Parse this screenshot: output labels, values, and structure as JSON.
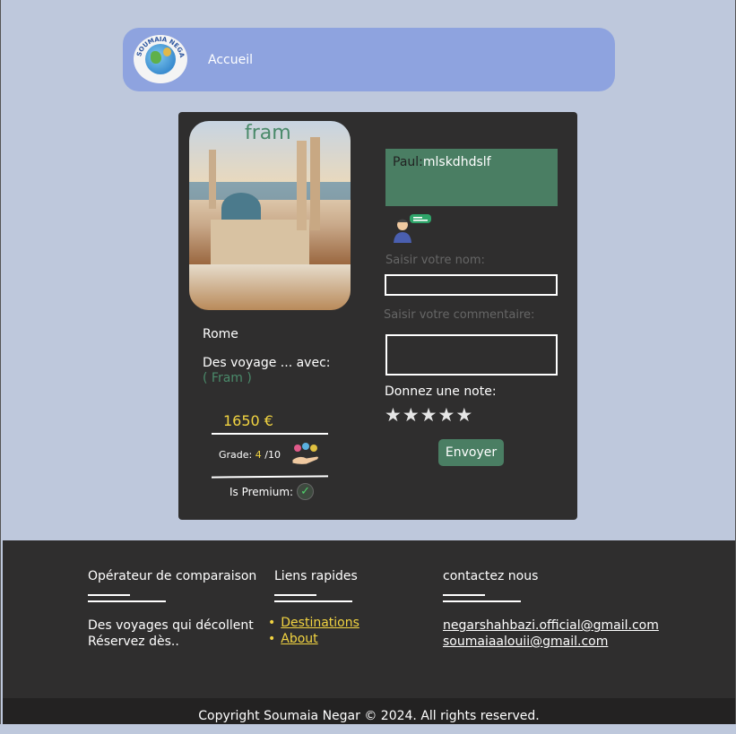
{
  "navbar": {
    "logo_text": "SOUMAIA NEGAR",
    "link_home": "Accueil"
  },
  "card": {
    "place": "Rome",
    "desc_label": "Des voyage ... avec:",
    "guide": "( Fram )",
    "price": "1650 €",
    "grade_label": "Grade:",
    "grade_value": "4",
    "grade_max": "/10",
    "premium_label": "Is Premium:",
    "premium": true
  },
  "review": {
    "name": "fram",
    "comment_author": "Paul:",
    "comment_text": "mlskdhdslf",
    "name_label": "Saisir votre  nom:",
    "comment_label": "Saisir votre  commentaire:",
    "rating_label": "Donnez une note:",
    "stars": [
      "★",
      "★",
      "★",
      "★",
      "★"
    ],
    "submit_label": "Envoyer"
  },
  "footer": {
    "col1_title": "Opérateur de comparaison",
    "col1_text_1": "Des voyages qui décollent",
    "col1_text_2": "Réservez dès..",
    "col2_title": "Liens rapides",
    "links": [
      "Destinations",
      "About"
    ],
    "col3_title": "contactez nous",
    "emails": [
      "negarshahbazi.official@gmail.com",
      "soumaiaalouii@gmail.com"
    ],
    "copyright": "Copyright Soumaia Negar © 2024. All rights reserved."
  },
  "colors": {
    "page_bg": "#bec8dc",
    "navbar_bg": "#8ea3df",
    "card_bg": "#2f2e2e",
    "accent_green": "#4a7e63",
    "accent_yellow": "#f2d441"
  }
}
